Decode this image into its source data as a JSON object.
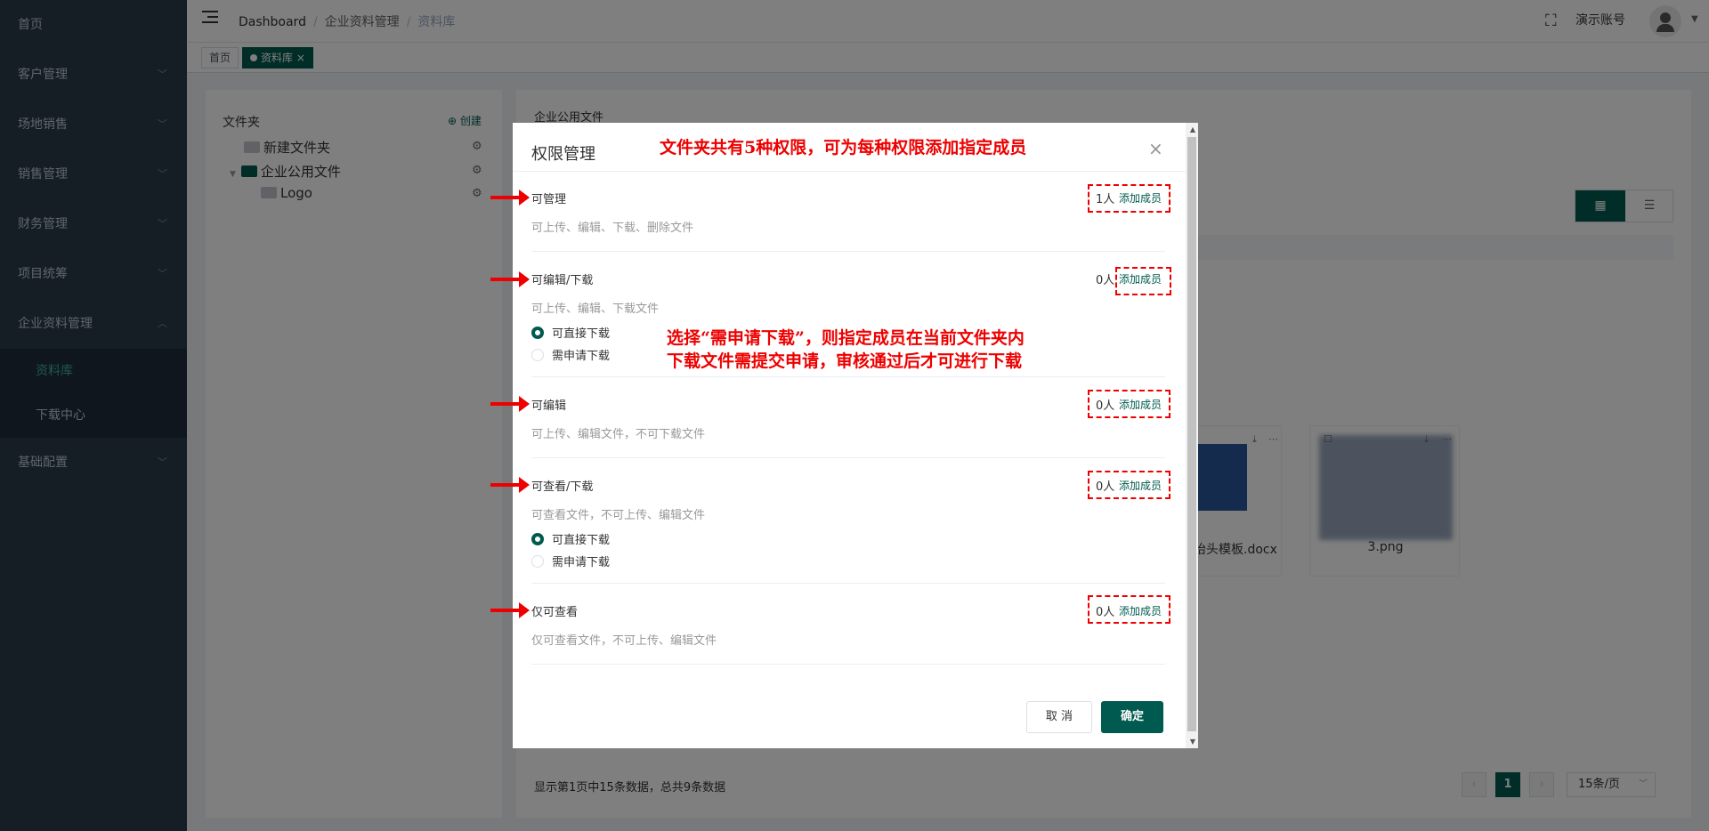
{
  "sidebar": {
    "items": [
      {
        "label": "首页"
      },
      {
        "label": "客户管理"
      },
      {
        "label": "场地销售"
      },
      {
        "label": "销售管理"
      },
      {
        "label": "财务管理"
      },
      {
        "label": "项目统筹"
      },
      {
        "label": "企业资料管理"
      },
      {
        "label": "基础配置"
      }
    ],
    "submenu": [
      {
        "label": "资料库"
      },
      {
        "label": "下载中心"
      }
    ]
  },
  "header": {
    "breadcrumb": [
      "Dashboard",
      "企业资料管理",
      "资料库"
    ],
    "account": "演示账号"
  },
  "tags": [
    {
      "label": "首页"
    },
    {
      "label": "资料库"
    }
  ],
  "left_panel": {
    "title": "文件夹",
    "create": "创建",
    "folders": [
      "新建文件夹",
      "企业公用文件",
      "Logo"
    ]
  },
  "right_panel": {
    "title": "企业公用文件",
    "files": [
      {
        "name": "抬头模板.docx"
      },
      {
        "name": "3.png"
      }
    ],
    "footer": "显示第1页中15条数据，总共9条数据",
    "page": "1",
    "page_size": "15条/页"
  },
  "dialog": {
    "title": "权限管理",
    "add_member": "添加成员",
    "permissions": [
      {
        "name": "可管理",
        "desc": "可上传、编辑、下载、删除文件",
        "count": "1人"
      },
      {
        "name": "可编辑/下载",
        "desc": "可上传、编辑、下载文件",
        "count": "0人"
      },
      {
        "name": "可编辑",
        "desc": "可上传、编辑文件，不可下载文件",
        "count": "0人"
      },
      {
        "name": "可查看/下载",
        "desc": "可查看文件，不可上传、编辑文件",
        "count": "0人"
      },
      {
        "name": "仅可查看",
        "desc": "仅可查看文件，不可上传、编辑文件",
        "count": "0人"
      }
    ],
    "radio_direct": "可直接下载",
    "radio_request": "需申请下载",
    "cancel": "取 消",
    "ok": "确定"
  },
  "annotations": {
    "top": "文件夹共有5种权限，可为每种权限添加指定成员",
    "mid_line1": "选择“需申请下载”，则指定成员在当前文件夹内",
    "mid_line2": "下载文件需提交申请，审核通过后才可进行下载"
  },
  "colors": {
    "primary": "#005a4f",
    "sidebar": "#2b3a4a",
    "annotation": "#ee0000"
  }
}
